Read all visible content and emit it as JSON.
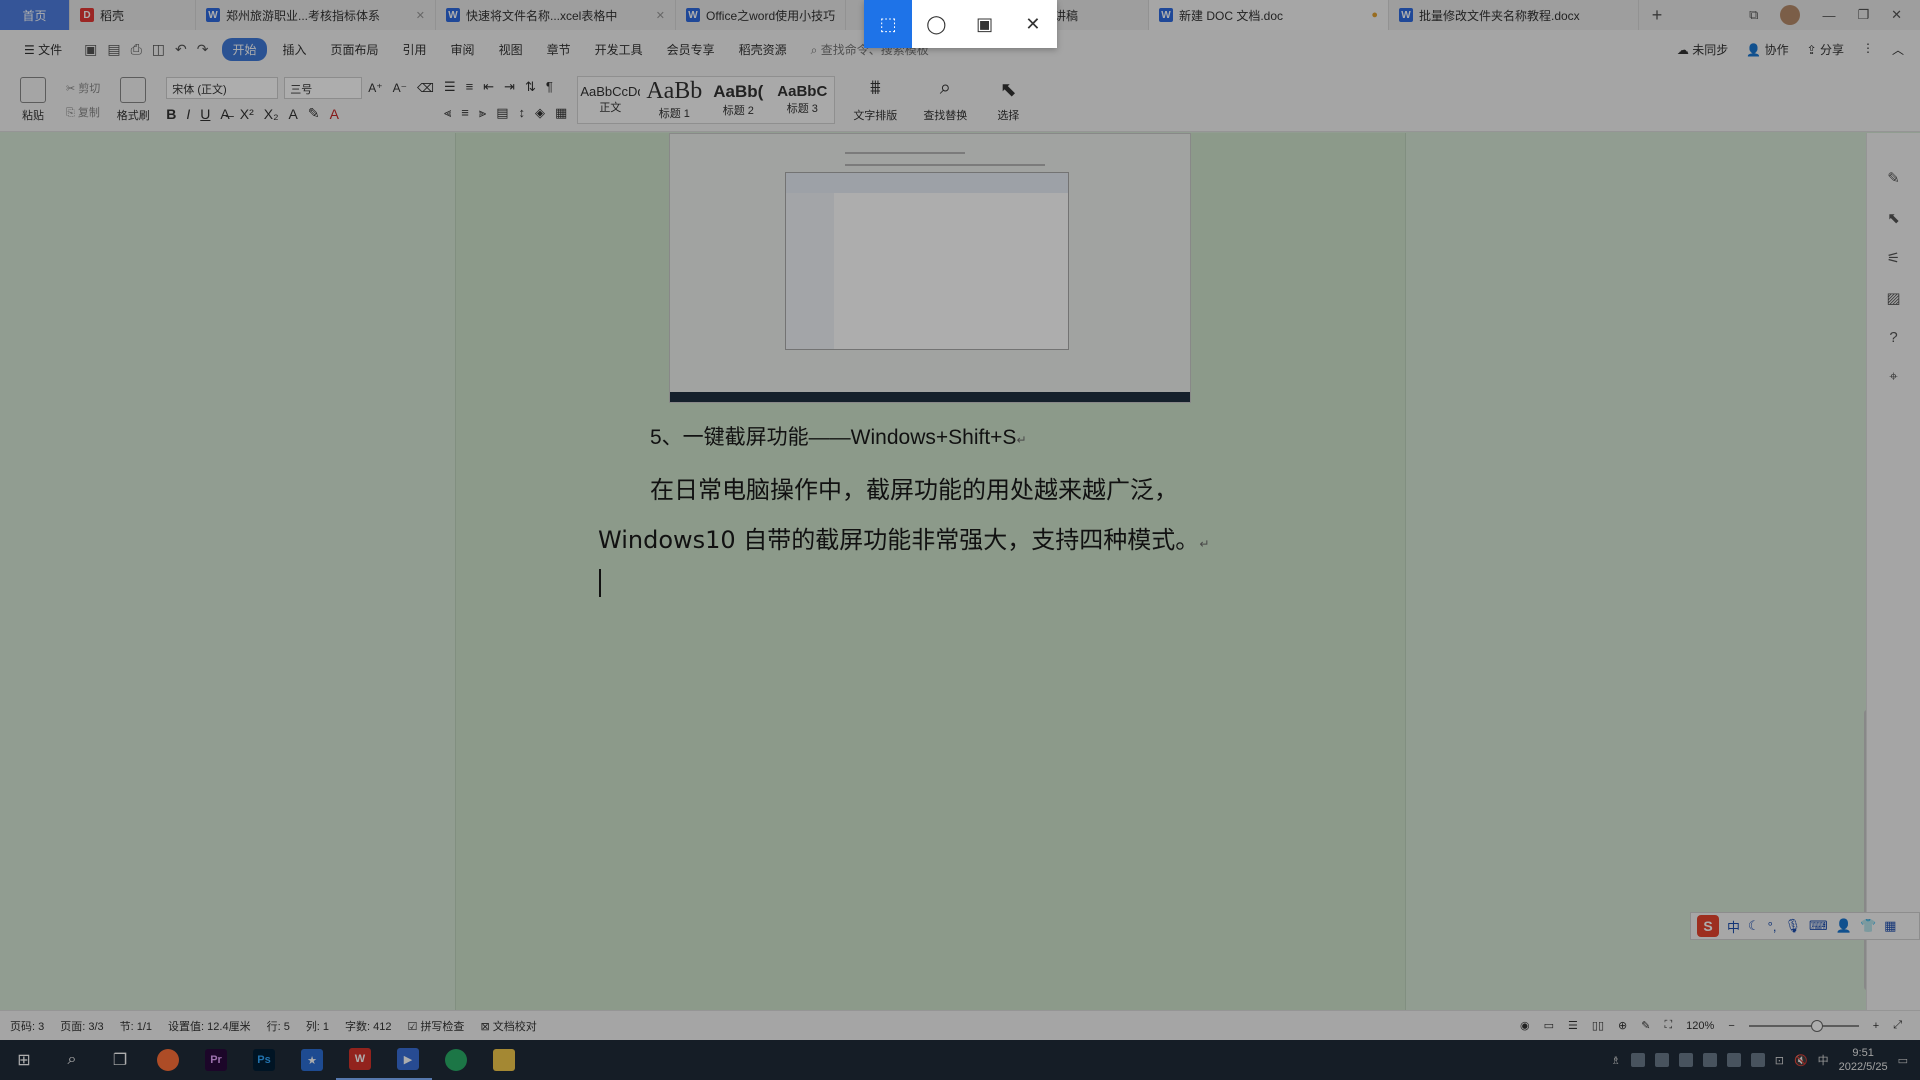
{
  "tabs": [
    {
      "label": "首页",
      "icon": "",
      "color": "#4f7ee0"
    },
    {
      "label": "稻壳",
      "icon": "docer-icon",
      "color": "#e53935"
    },
    {
      "label": "郑州旅游职业...考核指标体系",
      "icon": "wps-writer-icon",
      "color": "#2f6be0"
    },
    {
      "label": "快速将文件名称...xcel表格中",
      "icon": "wps-writer-icon",
      "color": "#2f6be0"
    },
    {
      "label": "Office之word使用小技巧",
      "icon": "wps-writer-icon",
      "color": "#2f6be0"
    },
    {
      "label": "(化讲稿",
      "icon": "",
      "color": "#2f6be0"
    },
    {
      "label": "新建 DOC 文档.doc",
      "icon": "wps-writer-icon",
      "color": "#2f6be0"
    },
    {
      "label": "批量修改文件夹名称教程.docx",
      "icon": "wps-writer-icon",
      "color": "#2f6be0"
    }
  ],
  "snip_toolbar": {
    "buttons": [
      "rect-snip-icon",
      "freeform-snip-icon",
      "window-snip-icon",
      "close-icon"
    ]
  },
  "menu": {
    "file": "文件",
    "items": [
      "开始",
      "插入",
      "页面布局",
      "引用",
      "审阅",
      "视图",
      "章节",
      "开发工具",
      "会员专享",
      "稻壳资源"
    ],
    "search_placeholder": "查找命令、搜索模板",
    "unsynced": "未同步",
    "collab": "协作",
    "share": "分享"
  },
  "ribbon": {
    "paste": "粘贴",
    "cut": "剪切",
    "copy": "复制",
    "format_painter": "格式刷",
    "font_name": "宋体 (正文)",
    "font_size": "三号",
    "styles": [
      {
        "sample": "AaBbCcDd",
        "name": "正文"
      },
      {
        "sample": "AaBb",
        "name": "标题 1"
      },
      {
        "sample": "AaBb(",
        "name": "标题 2"
      },
      {
        "sample": "AaBbC",
        "name": "标题 3"
      }
    ],
    "text_layout": "文字排版",
    "find_replace": "查找替换",
    "select": "选择"
  },
  "document": {
    "heading": "5、一键截屏功能——Windows+Shift+S",
    "para_line1": "在日常电脑操作中，截屏功能的用处越来越广泛，",
    "para_line2": "Windows10 自带的截屏功能非常强大，支持四种模式。",
    "para_mark": "↵"
  },
  "ime": {
    "logo": "S",
    "mode": "中"
  },
  "status": {
    "page_num": "页码: 3",
    "pages": "页面: 3/3",
    "section": "节: 1/1",
    "setting": "设置值: 12.4厘米",
    "row": "行: 5",
    "col": "列: 1",
    "words": "字数: 412",
    "spell_check": "拼写检查",
    "proofread": "文档校对",
    "zoom": "120%",
    "zoom_level": 0.62
  },
  "taskbar": {
    "apps": [
      {
        "name": "firefox",
        "label": "",
        "color": "#ff7139"
      },
      {
        "name": "premiere",
        "label": "Pr",
        "color": "#2a0a3d"
      },
      {
        "name": "photoshop",
        "label": "Ps",
        "color": "#001e36"
      },
      {
        "name": "star-app",
        "label": "★",
        "color": "#2d6fd6"
      },
      {
        "name": "wps",
        "label": "W",
        "color": "#d8342b"
      },
      {
        "name": "recorder",
        "label": "▶",
        "color": "#3a6fd8"
      },
      {
        "name": "wechat",
        "label": "",
        "color": "#2aae67"
      },
      {
        "name": "explorer",
        "label": "",
        "color": "#f2c94c"
      }
    ],
    "ime": "中",
    "time": "9:51",
    "date": "2022/5/25"
  }
}
